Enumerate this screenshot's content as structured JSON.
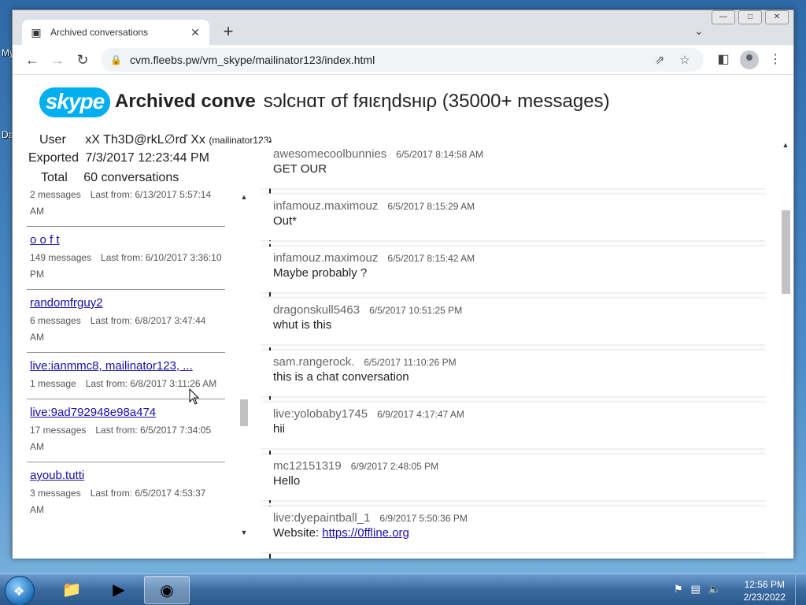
{
  "desktop": {
    "labels": [
      "My",
      "Da"
    ]
  },
  "browser": {
    "tab_title": "Archived conversations",
    "new_tab_symbol": "+",
    "url": "cvm.fleebs.pw/vm_skype/mailinator123/index.html"
  },
  "page": {
    "logo_text": "skype",
    "title": "Archived conve",
    "conversation_title": "sɔlcнɑт σf fяιεηdѕнιρ (35000+ messages)",
    "meta": {
      "user_label": "User",
      "user_value": "xX Th3D@rkL∅rď Xx",
      "user_extra": "(mailinator123)",
      "exported_label": "Exported",
      "exported_value": "7/3/2017 12:23:44 PM",
      "total_label": "Total",
      "total_value": "60 conversations"
    },
    "conversations": [
      {
        "name": "",
        "count": "2 messages",
        "last": "Last from: 6/13/2017 5:57:14 AM"
      },
      {
        "name": "o o f t",
        "count": "149 messages",
        "last": "Last from: 6/10/2017 3:36:10 PM"
      },
      {
        "name": "randomfrguy2",
        "count": "6 messages",
        "last": "Last from: 6/8/2017 3:47:44 AM"
      },
      {
        "name": "live:ianmmc8, mailinator123, ...",
        "count": "1 message",
        "last": "Last from: 6/8/2017 3:11:26 AM"
      },
      {
        "name": "live:9ad792948e98a474",
        "count": "17 messages",
        "last": "Last from: 6/5/2017 7:34:05 AM"
      },
      {
        "name": "ayoub.tutti",
        "count": "3 messages",
        "last": "Last from: 6/5/2017 4:53:37 AM"
      }
    ],
    "messages": [
      {
        "author": "awesomecoolbunnies",
        "time": "6/5/2017 8:14:58 AM",
        "text": "GET OUR"
      },
      {
        "author": "infamouz.maximouz",
        "time": "6/5/2017 8:15:29 AM",
        "text": "Out*"
      },
      {
        "author": "infamouz.maximouz",
        "time": "6/5/2017 8:15:42 AM",
        "text": "Maybe probably ?"
      },
      {
        "author": "dragonskull5463",
        "time": "6/5/2017 10:51:25 PM",
        "text": "whut is this"
      },
      {
        "author": "sam.rangerock.",
        "time": "6/5/2017 11:10:26 PM",
        "text": "this is a chat conversation"
      },
      {
        "author": "live:yolobaby1745",
        "time": "6/9/2017 4:17:47 AM",
        "text": "hii"
      },
      {
        "author": "mc12151319",
        "time": "6/9/2017 2:48:05 PM",
        "text": "Hello"
      },
      {
        "author": "live:dyepaintball_1",
        "time": "6/9/2017 5:50:36 PM",
        "text": "Website: ",
        "link": "https://0ffline.org"
      }
    ]
  },
  "taskbar": {
    "time": "12:56 PM",
    "date": "2/23/2022"
  }
}
